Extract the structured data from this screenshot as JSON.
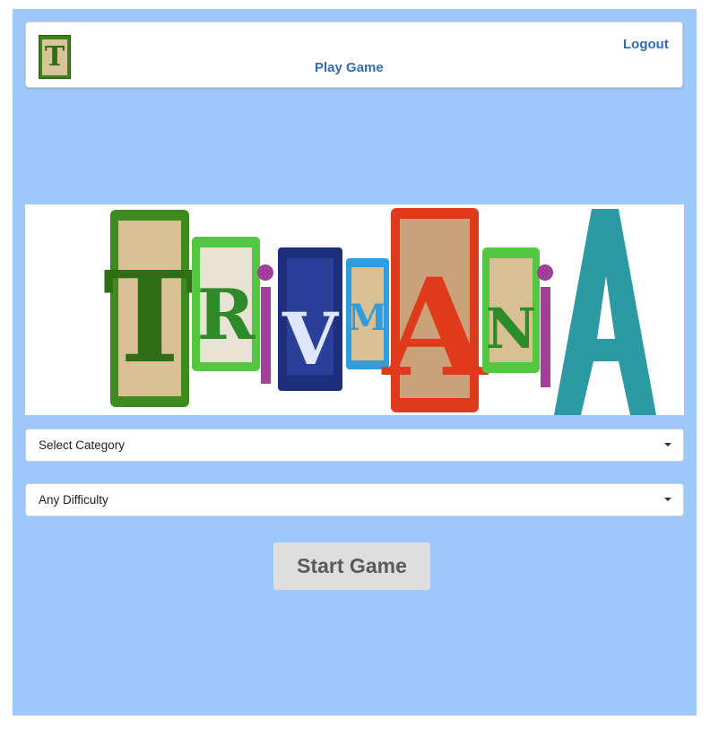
{
  "navbar": {
    "logo_letter": "T",
    "play_label": "Play Game",
    "logout_label": "Logout"
  },
  "banner": {
    "image_name": "trivmania-banner",
    "letters": [
      "T",
      "R",
      "i",
      "V",
      "M",
      "A",
      "N",
      "i",
      "A"
    ],
    "colors": {
      "green": "#3d8a20",
      "lime": "#53c742",
      "navy": "#1d2f7c",
      "sky": "#2f9ee0",
      "red": "#e03a1c",
      "purple": "#a0409a",
      "teal": "#2b9aa3",
      "wood": "#d9bf94"
    }
  },
  "form": {
    "category_value": "Select Category",
    "difficulty_value": "Any Difficulty",
    "start_label": "Start Game"
  },
  "colors": {
    "background": "#9ec8fb",
    "link": "#2f6db3",
    "button": "#dedede"
  }
}
